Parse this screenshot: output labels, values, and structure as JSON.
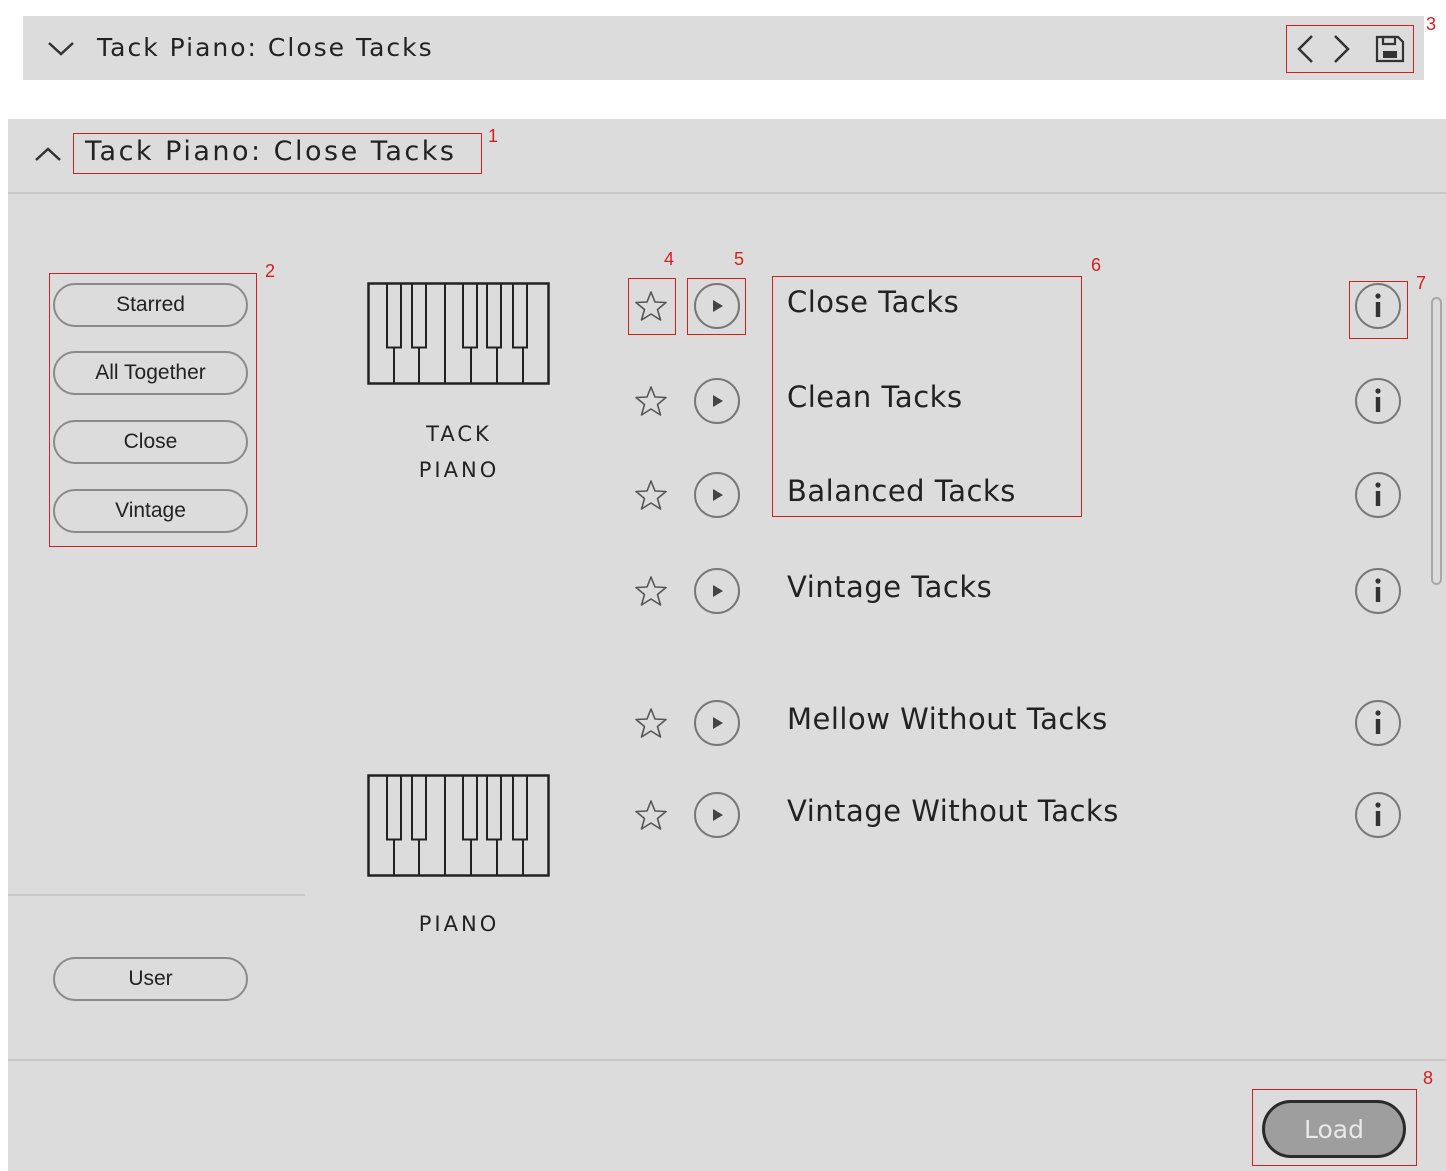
{
  "header": {
    "title": "Tack Piano: Close Tacks"
  },
  "panel": {
    "title": "Tack Piano: Close Tacks"
  },
  "filters": [
    "Starred",
    "All Together",
    "Close",
    "Vintage"
  ],
  "user_button": "User",
  "instruments": [
    {
      "line1": "TACK",
      "line2": "PIANO"
    },
    {
      "line1": "PIANO",
      "line2": ""
    }
  ],
  "presets": [
    "Close Tacks",
    "Clean Tacks",
    "Balanced Tacks",
    "Vintage Tacks",
    "Mellow Without Tacks",
    "Vintage Without Tacks"
  ],
  "load_button": "Load",
  "annotations": [
    "1",
    "2",
    "3",
    "4",
    "5",
    "6",
    "7",
    "8"
  ],
  "colors": {
    "panel": "#dcdcdc",
    "annotation": "#d21f1f",
    "load_fill": "#9e9e9e"
  },
  "icons": [
    "chevron-down-icon",
    "chevron-up-icon",
    "chevron-left-icon",
    "chevron-right-icon",
    "save-icon",
    "piano-keys-icon",
    "star-icon",
    "play-icon",
    "info-icon"
  ]
}
